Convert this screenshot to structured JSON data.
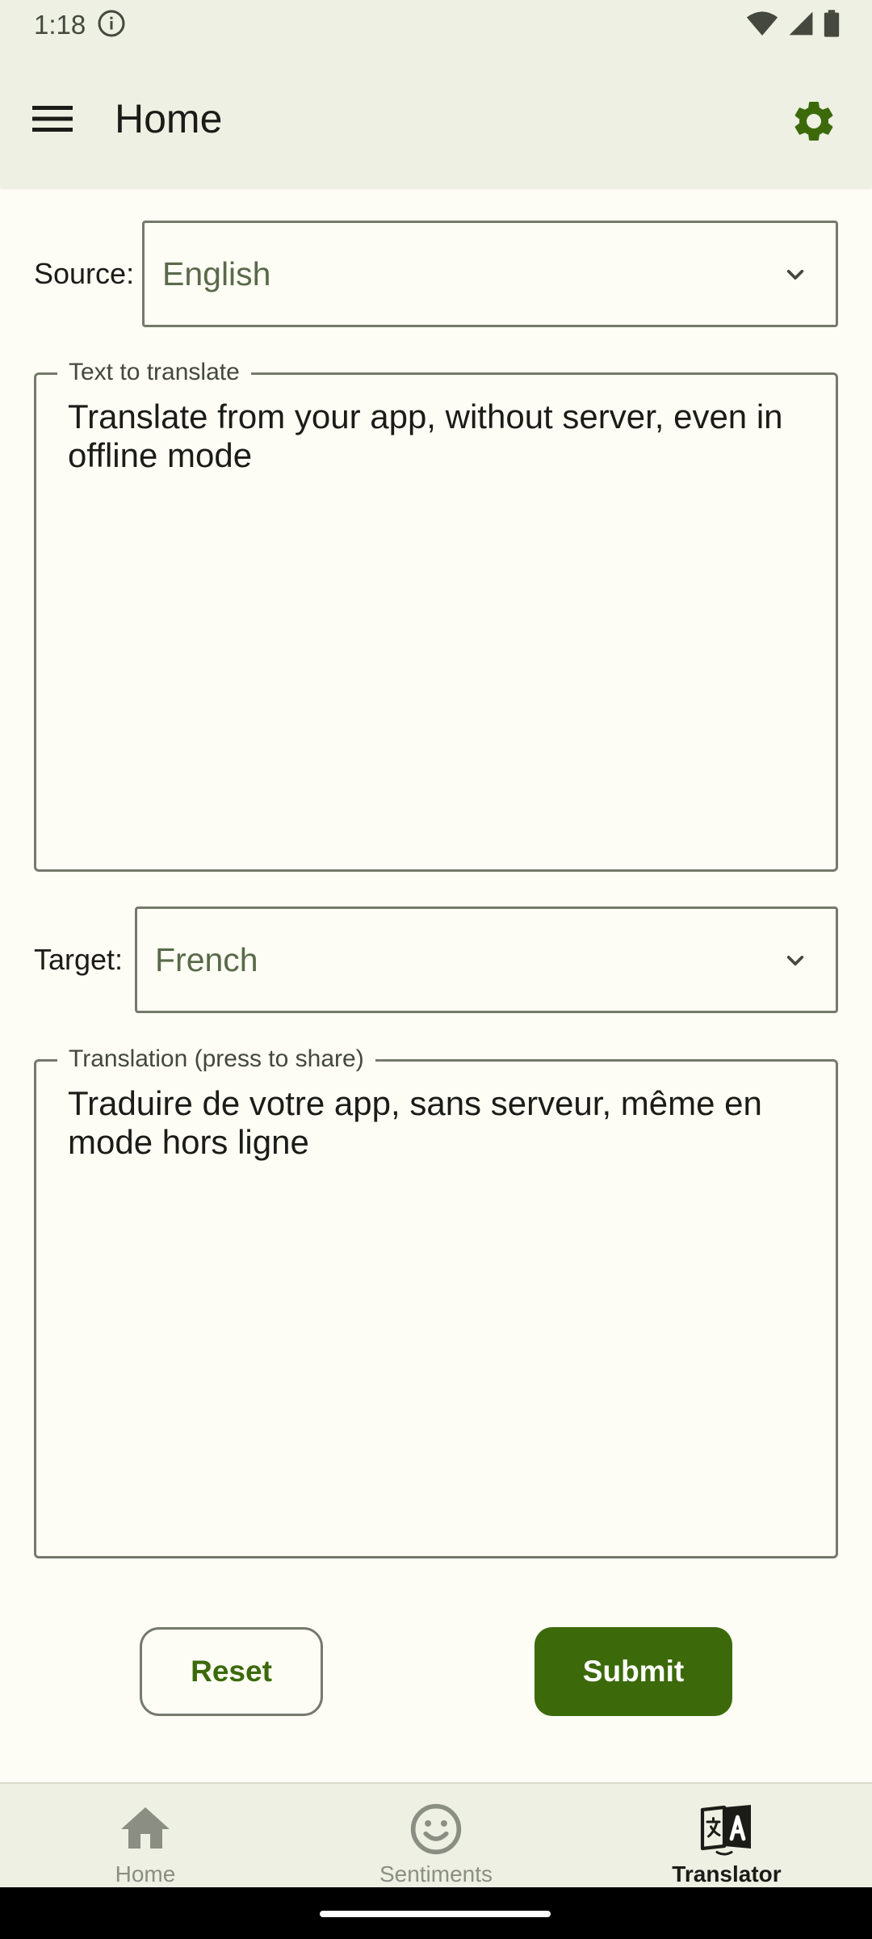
{
  "status_bar": {
    "time": "1:18"
  },
  "app_bar": {
    "title": "Home"
  },
  "source": {
    "label": "Source:",
    "value": "English"
  },
  "input_field": {
    "label": "Text to translate",
    "text": "Translate from your app, without server, even in offline mode"
  },
  "target": {
    "label": "Target:",
    "value": "French"
  },
  "output_field": {
    "label": "Translation (press to share)",
    "text": "Traduire de votre app, sans serveur, même en mode hors ligne"
  },
  "buttons": {
    "reset": "Reset",
    "submit": "Submit"
  },
  "bottom_nav": {
    "items": [
      {
        "label": "Home",
        "icon": "home-icon",
        "active": false
      },
      {
        "label": "Sentiments",
        "icon": "smiley-icon",
        "active": false
      },
      {
        "label": "Translator",
        "icon": "translate-icon",
        "active": true
      }
    ]
  },
  "colors": {
    "accent": "#3c6a0b",
    "surface": "#edf0e2",
    "background": "#fdfdf5",
    "outline": "#75796c"
  }
}
